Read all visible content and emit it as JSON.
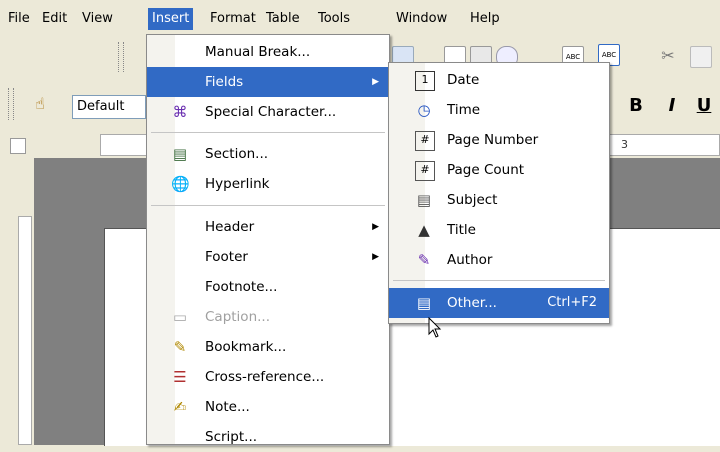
{
  "menubar": [
    "File",
    "Edit",
    "View",
    "Insert",
    "Format",
    "Table",
    "Tools",
    "Window",
    "Help"
  ],
  "menubar_active": "Insert",
  "toolbar": {
    "paragraph_style": "Default",
    "bold_label": "B",
    "italic_label": "I",
    "underline_label": "U"
  },
  "ruler": {
    "tick_label": "3"
  },
  "insert_menu": {
    "items": [
      {
        "label": "Manual Break...",
        "icon": ""
      },
      {
        "label": "Fields",
        "icon": "",
        "submenu": true,
        "highlighted": true
      },
      {
        "label": "Special Character...",
        "icon": "special-character-icon"
      },
      {
        "label": "Section...",
        "icon": "section-icon"
      },
      {
        "label": "Hyperlink",
        "icon": "hyperlink-icon"
      },
      {
        "label": "Header",
        "icon": "",
        "submenu": true
      },
      {
        "label": "Footer",
        "icon": "",
        "submenu": true
      },
      {
        "label": "Footnote...",
        "icon": ""
      },
      {
        "label": "Caption...",
        "icon": "caption-icon",
        "disabled": true
      },
      {
        "label": "Bookmark...",
        "icon": "bookmark-icon"
      },
      {
        "label": "Cross-reference...",
        "icon": "cross-reference-icon"
      },
      {
        "label": "Note...",
        "icon": "note-icon"
      },
      {
        "label": "Script...",
        "icon": ""
      }
    ]
  },
  "fields_menu": {
    "items": [
      {
        "label": "Date",
        "icon": "date-icon"
      },
      {
        "label": "Time",
        "icon": "time-icon"
      },
      {
        "label": "Page Number",
        "icon": "page-number-icon"
      },
      {
        "label": "Page Count",
        "icon": "page-count-icon"
      },
      {
        "label": "Subject",
        "icon": "subject-icon"
      },
      {
        "label": "Title",
        "icon": "title-icon"
      },
      {
        "label": "Author",
        "icon": "author-icon"
      },
      {
        "label": "Other...",
        "icon": "other-fields-icon",
        "shortcut": "Ctrl+F2",
        "highlighted": true
      }
    ]
  },
  "colors": {
    "highlight": "#316ac5",
    "menu_bg": "#ffffff",
    "chrome": "#ece9d8",
    "doc_bg": "#808080"
  }
}
